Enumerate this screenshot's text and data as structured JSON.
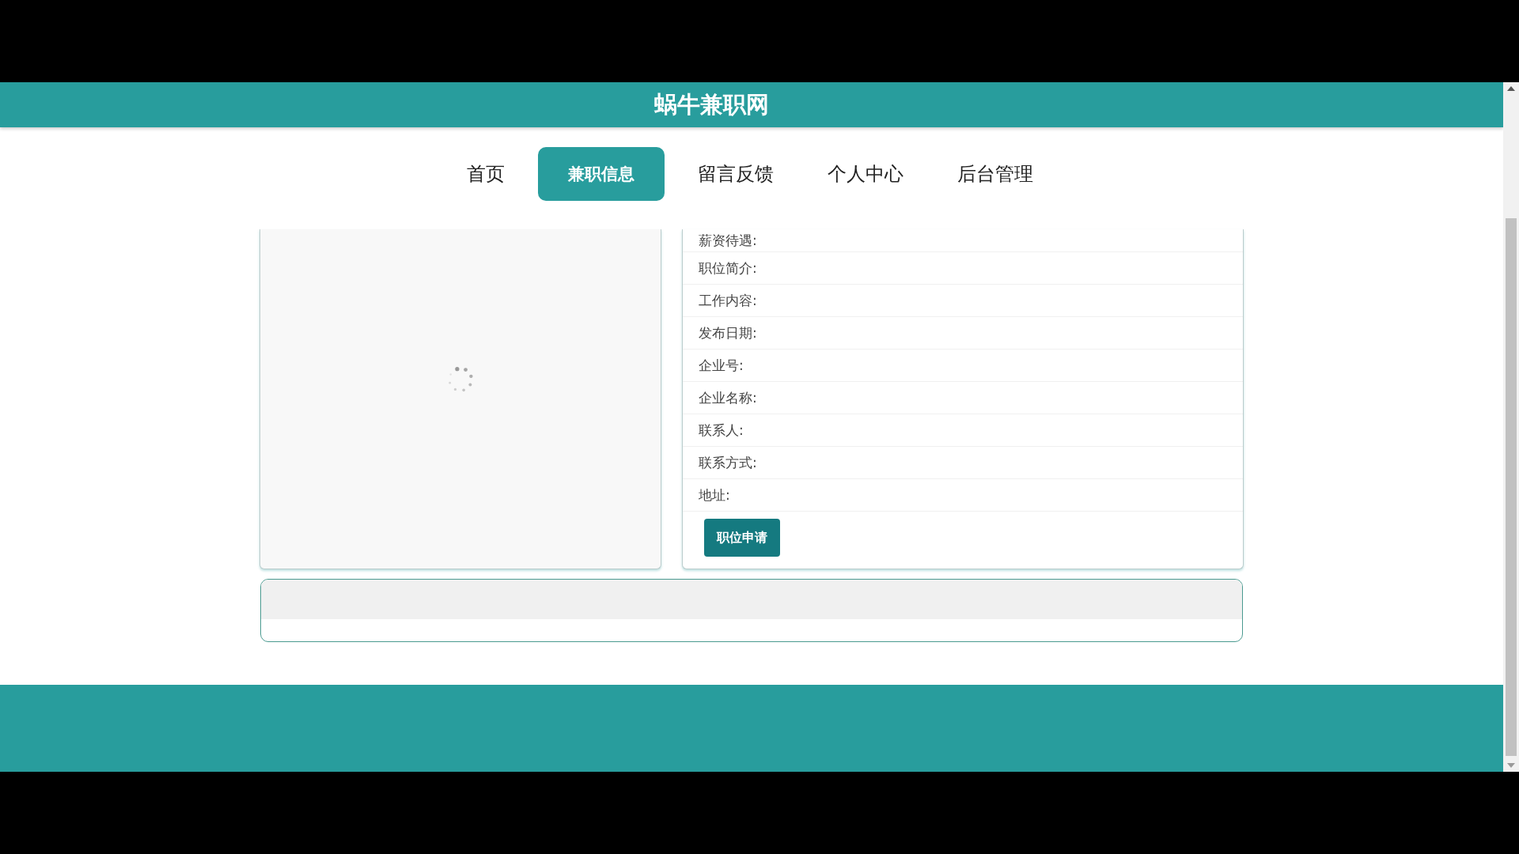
{
  "header": {
    "title": "蜗牛兼职网"
  },
  "nav": [
    {
      "label": "首页",
      "selected": false
    },
    {
      "label": "兼职信息",
      "selected": true
    },
    {
      "label": "留言反馈",
      "selected": false
    },
    {
      "label": "个人中心",
      "selected": false
    },
    {
      "label": "后台管理",
      "selected": false
    }
  ],
  "image_panel": {
    "loading": true
  },
  "details": [
    {
      "label": "薪资待遇:"
    },
    {
      "label": "职位简介:"
    },
    {
      "label": "工作内容:"
    },
    {
      "label": "发布日期:"
    },
    {
      "label": "企业号:"
    },
    {
      "label": "企业名称:"
    },
    {
      "label": "联系人:"
    },
    {
      "label": "联系方式:"
    },
    {
      "label": "地址:"
    }
  ],
  "apply_button": "职位申请"
}
